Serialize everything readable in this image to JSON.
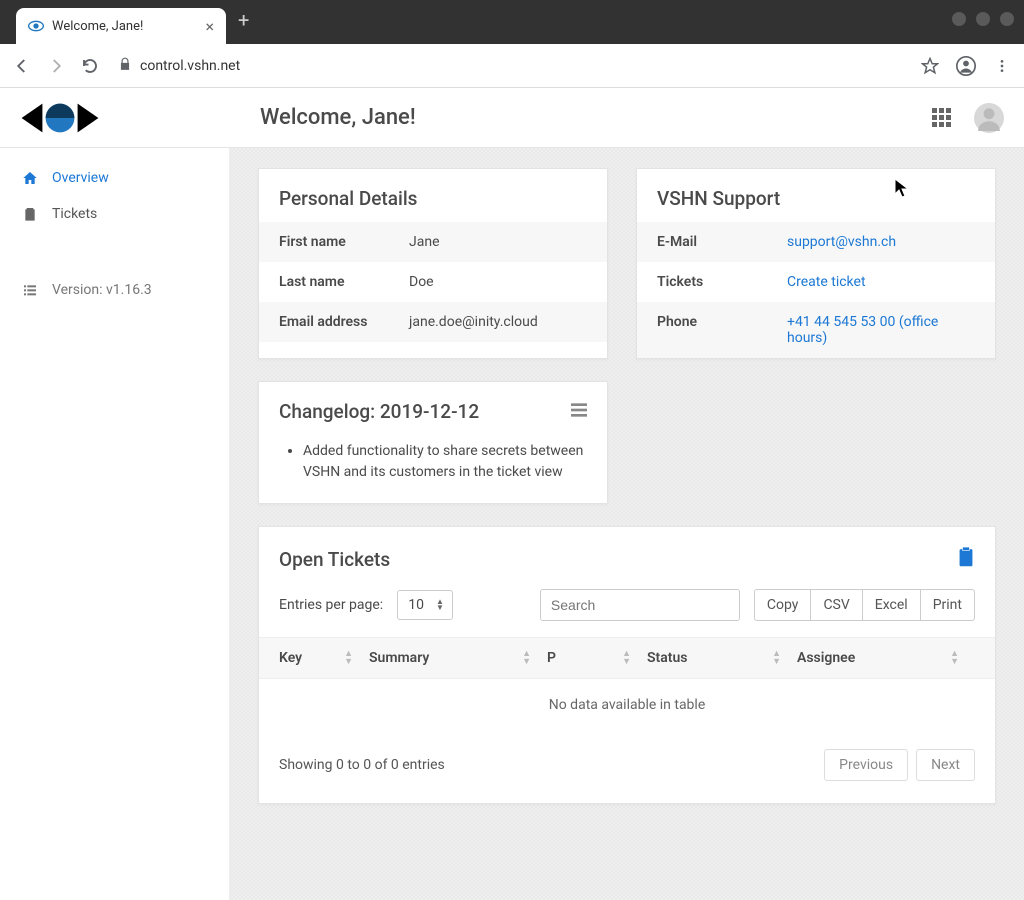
{
  "browser": {
    "tab_title": "Welcome, Jane!",
    "url": "control.vshn.net"
  },
  "header": {
    "welcome": "Welcome, Jane!"
  },
  "sidebar": {
    "items": [
      {
        "label": "Overview"
      },
      {
        "label": "Tickets"
      }
    ],
    "version_label": "Version: v1.16.3"
  },
  "personal_details": {
    "title": "Personal Details",
    "rows": [
      {
        "label": "First name",
        "value": "Jane"
      },
      {
        "label": "Last name",
        "value": "Doe"
      },
      {
        "label": "Email address",
        "value": "jane.doe@inity.cloud"
      }
    ]
  },
  "support": {
    "title": "VSHN Support",
    "rows": [
      {
        "label": "E-Mail",
        "value": "support@vshn.ch",
        "link": true
      },
      {
        "label": "Tickets",
        "value": "Create ticket",
        "link": true
      },
      {
        "label": "Phone",
        "value": "+41 44 545 53 00 (office hours)",
        "link": true
      }
    ]
  },
  "changelog": {
    "title": "Changelog: 2019-12-12",
    "item": "Added functionality to share secrets between VSHN and its customers in the ticket view"
  },
  "tickets": {
    "title": "Open Tickets",
    "entries_label": "Entries per page:",
    "entries_value": "10",
    "search_placeholder": "Search",
    "buttons": {
      "copy": "Copy",
      "csv": "CSV",
      "excel": "Excel",
      "print": "Print"
    },
    "columns": {
      "key": "Key",
      "summary": "Summary",
      "p": "P",
      "status": "Status",
      "assignee": "Assignee"
    },
    "no_data": "No data available in table",
    "showing": "Showing 0 to 0 of 0 entries",
    "previous": "Previous",
    "next": "Next"
  }
}
